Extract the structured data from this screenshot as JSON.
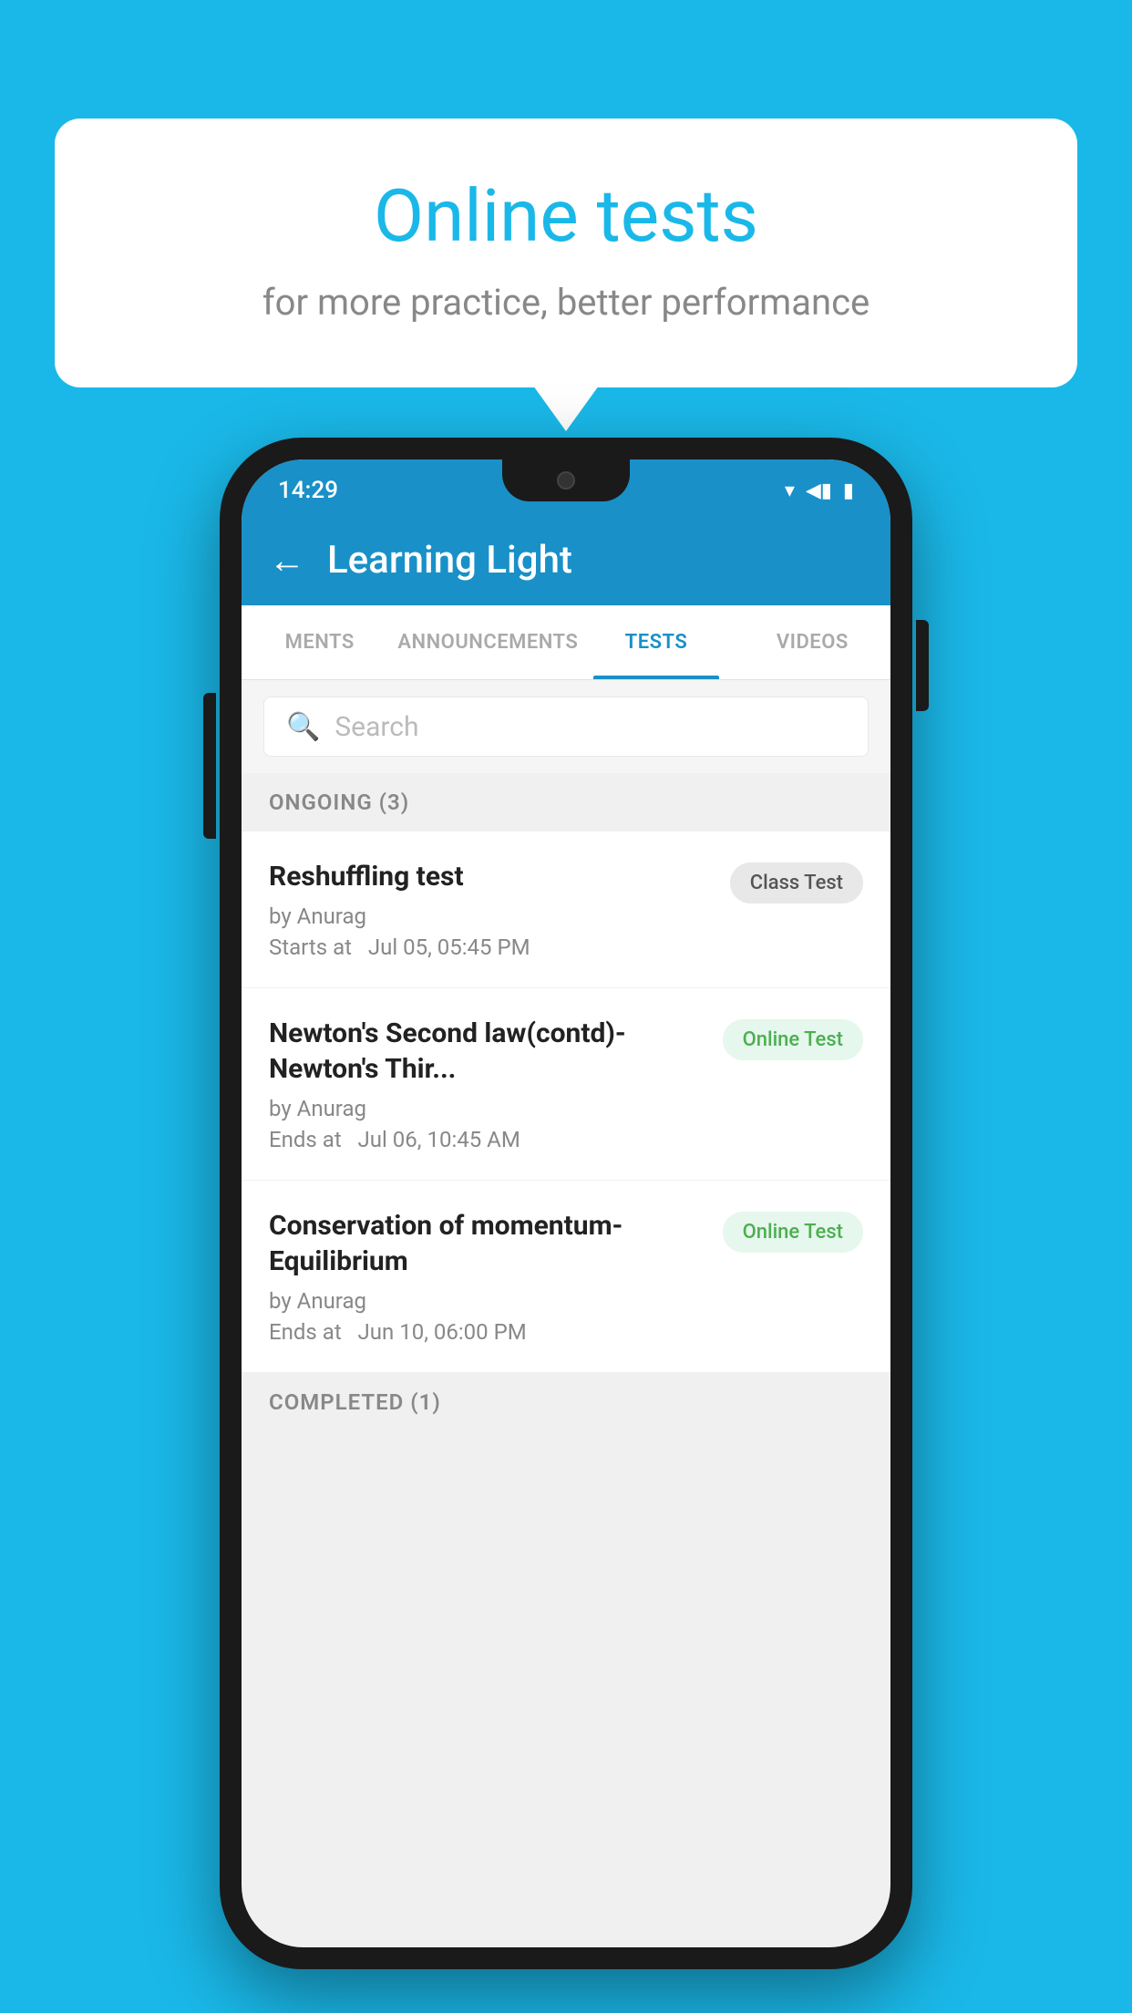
{
  "background": {
    "color": "#1ab8e8"
  },
  "speech_bubble": {
    "title": "Online tests",
    "subtitle": "for more practice, better performance"
  },
  "phone": {
    "status_bar": {
      "time": "14:29",
      "wifi": "▾",
      "signal": "◀",
      "battery": "▮"
    },
    "app_bar": {
      "title": "Learning Light",
      "back_label": "←"
    },
    "tabs": [
      {
        "label": "MENTS",
        "active": false
      },
      {
        "label": "ANNOUNCEMENTS",
        "active": false
      },
      {
        "label": "TESTS",
        "active": true
      },
      {
        "label": "VIDEOS",
        "active": false
      }
    ],
    "search": {
      "placeholder": "Search"
    },
    "ongoing_section": {
      "label": "ONGOING (3)"
    },
    "tests": [
      {
        "name": "Reshuffling test",
        "author": "by Anurag",
        "time_label": "Starts at",
        "time": "Jul 05, 05:45 PM",
        "badge": "Class Test",
        "badge_type": "class"
      },
      {
        "name": "Newton's Second law(contd)-Newton's Thir...",
        "author": "by Anurag",
        "time_label": "Ends at",
        "time": "Jul 06, 10:45 AM",
        "badge": "Online Test",
        "badge_type": "online"
      },
      {
        "name": "Conservation of momentum-Equilibrium",
        "author": "by Anurag",
        "time_label": "Ends at",
        "time": "Jun 10, 06:00 PM",
        "badge": "Online Test",
        "badge_type": "online"
      }
    ],
    "completed_section": {
      "label": "COMPLETED (1)"
    }
  }
}
